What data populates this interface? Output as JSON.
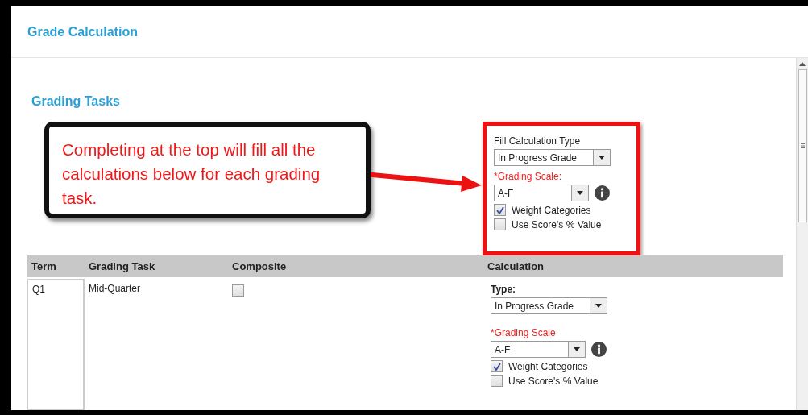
{
  "dialog": {
    "title": "Grade Calculation"
  },
  "section_title": "Grading Tasks",
  "callout": {
    "text": "Completing at the top will fill all the calculations below for each grading task."
  },
  "fill_panel": {
    "type_label": "Fill Calculation Type",
    "type_value": "In Progress Grade",
    "scale_label": "*Grading Scale:",
    "scale_value": "A-F",
    "options": [
      {
        "label": "Weight Categories",
        "checked": true
      },
      {
        "label": "Use Score's % Value",
        "checked": false
      }
    ]
  },
  "table": {
    "columns": [
      "Term",
      "Grading Task",
      "Composite",
      "Calculation"
    ],
    "rows": [
      {
        "term": "Q1",
        "task": "Mid-Quarter",
        "composite": false,
        "calculation": {
          "type_label": "Type:",
          "type_value": "In Progress Grade",
          "scale_label": "*Grading Scale",
          "scale_value": "A-F",
          "options": [
            {
              "label": "Weight Categories",
              "checked": true
            },
            {
              "label": "Use Score's % Value",
              "checked": false
            }
          ]
        }
      }
    ]
  }
}
